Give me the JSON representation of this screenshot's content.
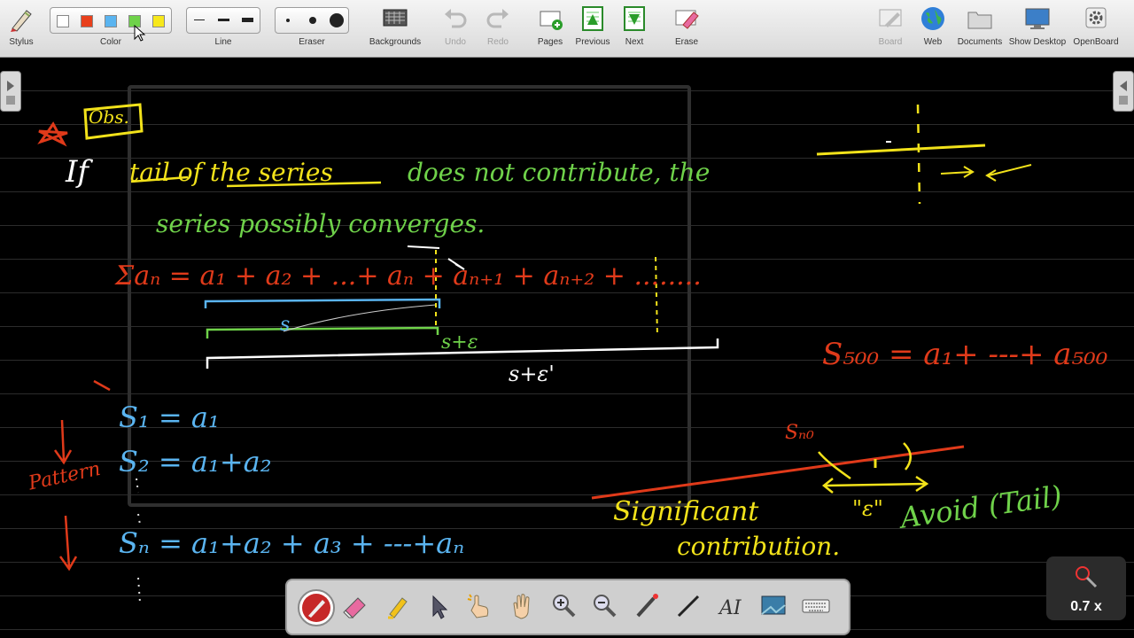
{
  "toolbar": {
    "stylus": "Stylus",
    "color": "Color",
    "line": "Line",
    "eraser": "Eraser",
    "backgrounds": "Backgrounds",
    "undo": "Undo",
    "redo": "Redo",
    "pages": "Pages",
    "previous": "Previous",
    "next": "Next",
    "erase": "Erase",
    "board": "Board",
    "web": "Web",
    "documents": "Documents",
    "show_desktop": "Show Desktop",
    "openboard": "OpenBoard",
    "colors": [
      "#ffffff",
      "#e8401c",
      "#5ab4f0",
      "#6fd24a",
      "#f7e81b"
    ]
  },
  "board": {
    "obs": "Obs.",
    "line1_if": "If",
    "line1_tail": "tail of the series",
    "line1_rest": "does not contribute, the",
    "line2": "series possibly converges.",
    "series_sum": "Σaₙ = a₁ + a₂ + ...+ aₙ + aₙ₊₁ + aₙ₊₂ + ........",
    "s_label": "s",
    "s_eps": "s+ε",
    "s_eps2": "s+ε'",
    "s1": "S₁ =   a₁",
    "s2": "S₂ =  a₁+a₂",
    "sn": "Sₙ = a₁+a₂ + a₃ + ---+aₙ",
    "pattern": "Pattern",
    "s500": "S₅₀₀ = a₁+ ---+ a₅₀₀",
    "s_n0": "Sₙ₀",
    "epsilon_q": "\"ε\"",
    "significant": "Significant",
    "contribution": "contribution.",
    "avoid_tail": "Avoid (Tail)"
  },
  "zoom": {
    "level": "0.7 x"
  }
}
